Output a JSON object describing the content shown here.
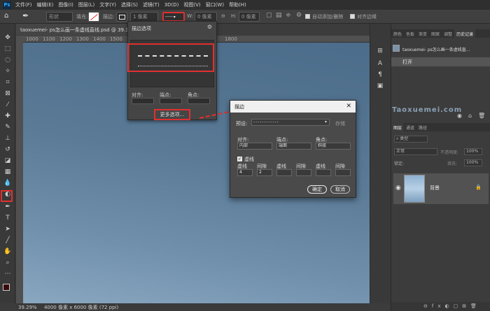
{
  "menubar": {
    "logo": "Ps",
    "items": [
      "文件(F)",
      "编辑(E)",
      "图像(I)",
      "图层(L)",
      "文字(Y)",
      "选择(S)",
      "滤镜(T)",
      "3D(D)",
      "视图(V)",
      "窗口(W)",
      "帮助(H)"
    ]
  },
  "optbar": {
    "shape_mode": "形状",
    "fill_label": "填充:",
    "stroke_label": "描边:",
    "stroke_width": "1 像素",
    "w_label": "W:",
    "w_value": "0 像素",
    "h_label": "H:",
    "h_value": "0 像素",
    "auto_add_delete": "自动添加/删除",
    "align_edges": "对齐边缘"
  },
  "document": {
    "tab_title": "taoxuemei- ps怎么画一条虚线直线.psd @ 39.3%(RGB",
    "ruler_numbers": [
      "1000",
      "1100",
      "1200",
      "1300",
      "1400",
      "1500",
      "1600",
      "1700",
      "1800"
    ],
    "status": "39.29%",
    "status_size": "4000 像素 x 6000 像素 (72 ppi)"
  },
  "stroke_options_panel": {
    "title": "描边选项",
    "align_label": "对齐:",
    "caps_label": "端点:",
    "corners_label": "角点:",
    "more_options": "更多选项..."
  },
  "stroke_dialog": {
    "title": "描边",
    "preset_label": "预设:",
    "save_label": "存储",
    "align_label": "对齐:",
    "align_value": "内部",
    "caps_label": "端点:",
    "caps_value": "端面",
    "corners_label": "角点:",
    "corners_value": "斜接",
    "dashed_label": "虚线",
    "dash_headers": [
      "虚线",
      "间隙",
      "虚线",
      "间隙",
      "虚线",
      "间隙"
    ],
    "dash_values": [
      "4",
      "2",
      "",
      "",
      "",
      ""
    ],
    "ok_label": "确定",
    "cancel_label": "取消"
  },
  "history_panel": {
    "tabs": [
      "颜色",
      "色板",
      "渐变",
      "图案",
      "调整",
      "历史记录"
    ],
    "snapshot_name": "taoxuemei- ps怎么画一条虚线直...",
    "open_step": "打开"
  },
  "watermark": "Taoxuemei.com",
  "layers_panel": {
    "tabs": [
      "图层",
      "通道",
      "路径"
    ],
    "filter_label": "类型",
    "blend_mode": "正常",
    "opacity_label": "不透明度:",
    "opacity_value": "100%",
    "lock_label": "锁定:",
    "fill_label": "填充:",
    "fill_value": "100%",
    "layer_name": "背景"
  },
  "colors": {
    "highlight": "#e03030",
    "accent": "#31a8ff"
  }
}
